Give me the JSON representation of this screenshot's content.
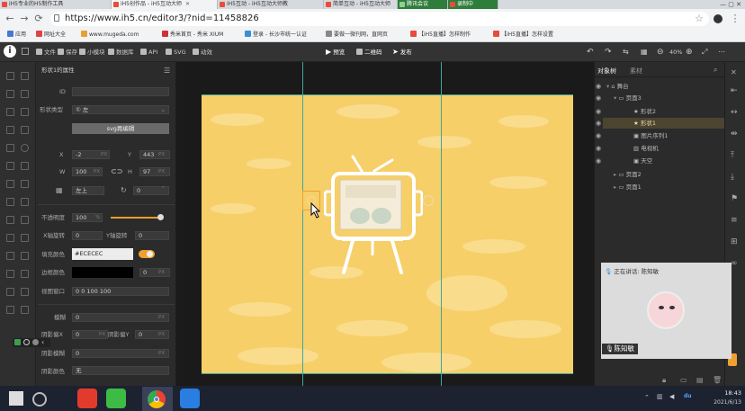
{
  "browser": {
    "tabs": [
      {
        "label": "iH5专业的H5制作工具",
        "active": false
      },
      {
        "label": "iH5创作品 - iH5互动大师",
        "active": true
      },
      {
        "label": "iH5互动 - iH5互动大师教",
        "active": false
      },
      {
        "label": "简单互动 - iH5互动大师",
        "active": false
      },
      {
        "label": "腾讯会议",
        "active": false
      },
      {
        "label": "录制中",
        "active": false
      }
    ],
    "url": "https://www.ih5.cn/editor3/?nid=11458826",
    "bookmarks": [
      "应用",
      "网址大全",
      "www.mugeda.com",
      "秀米首页 - 秀米 XIUM",
      "登录 - 长沙市统一认证",
      "要做一微刊网，直网页",
      "【iH5直播】怎样制作",
      "【iH5直播】怎样设置"
    ]
  },
  "toolbar": {
    "items": [
      "文件",
      "保存",
      "小模块",
      "数据库",
      "API",
      "SVG",
      "动效"
    ],
    "preview": "预览",
    "qrcode": "二维码",
    "publish": "发布",
    "zoom": "40%"
  },
  "props": {
    "title": "形状1的属性",
    "id_label": "ID",
    "shape_label": "形状类型",
    "shape_value": "① 左",
    "svg_button": "svg再编辑",
    "x_label": "X",
    "x_value": "-2",
    "y_label": "Y",
    "y_value": "443",
    "w_label": "W",
    "w_value": "100",
    "h_label": "H",
    "h_value": "97",
    "anchor_value": "左上",
    "rotation_value": "0",
    "opacity_label": "不透明度",
    "opacity_value": "100",
    "opacity_unit": "%",
    "xrot_label": "X轴旋转",
    "xrot_value": "0",
    "yrot_label": "Y轴旋转",
    "yrot_value": "0",
    "fill_label": "填充颜色",
    "fill_value": "#ECECEC",
    "border_color_label": "边框颜色",
    "border_width": "0",
    "viewbox_label": "视图窗口",
    "viewbox_value": "0 0 100 100",
    "blur_label": "模糊",
    "blur_value": "0",
    "shadow_x_label": "阴影偏X",
    "shadow_x_value": "0",
    "shadow_y_label": "阴影偏Y",
    "shadow_y_value": "0",
    "shadow_blur_label": "阴影模糊",
    "shadow_blur_value": "0",
    "shadow_color_label": "阴影颜色",
    "shadow_color_value": "无",
    "unit_px": "PX"
  },
  "rpanel": {
    "tabs": [
      "对象树",
      "素材"
    ],
    "tree": [
      {
        "label": "舞台",
        "indent": 0
      },
      {
        "label": "页面3",
        "indent": 1
      },
      {
        "label": "形状2",
        "indent": 2
      },
      {
        "label": "形状1",
        "indent": 2
      },
      {
        "label": "图片序列1",
        "indent": 2
      },
      {
        "label": "电视机",
        "indent": 2
      },
      {
        "label": "天空",
        "indent": 2
      },
      {
        "label": "页面2",
        "indent": 1
      },
      {
        "label": "页面1",
        "indent": 1
      }
    ]
  },
  "video": {
    "speaking": "正在讲话: 陈知敏",
    "name": "陈知敏"
  },
  "taskbar": {
    "time": "18:43",
    "date": "2021/6/13"
  },
  "colors": {
    "stage": "#f6cf69",
    "guide": "#3fa6a0",
    "fill_swatch": "#ECECEC",
    "accent": "#f0a030"
  }
}
